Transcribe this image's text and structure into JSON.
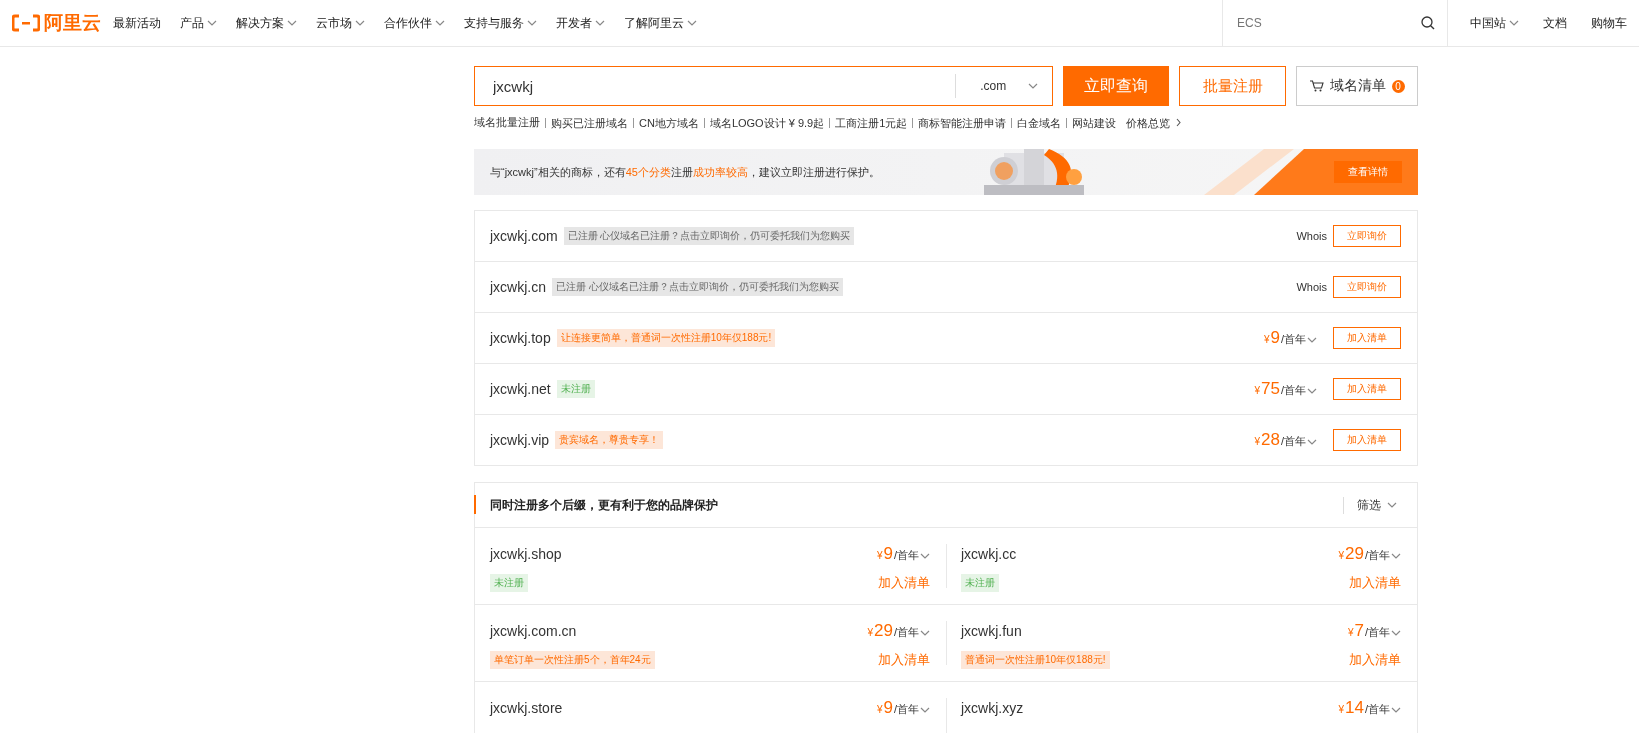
{
  "header": {
    "logo": "阿里云",
    "nav": [
      {
        "label": "最新活动",
        "dropdown": false
      },
      {
        "label": "产品",
        "dropdown": true
      },
      {
        "label": "解决方案",
        "dropdown": true
      },
      {
        "label": "云市场",
        "dropdown": true
      },
      {
        "label": "合作伙伴",
        "dropdown": true
      },
      {
        "label": "支持与服务",
        "dropdown": true
      },
      {
        "label": "开发者",
        "dropdown": true
      },
      {
        "label": "了解阿里云",
        "dropdown": true
      }
    ],
    "search": {
      "placeholder": "ECS"
    },
    "right": [
      {
        "label": "中国站",
        "dropdown": true
      },
      {
        "label": "文档",
        "dropdown": false
      },
      {
        "label": "购物车",
        "dropdown": false
      }
    ]
  },
  "search": {
    "value": "jxcwkj",
    "suffix": ".com",
    "button": "立即查询",
    "batch": "批量注册",
    "cart": {
      "label": "域名清单",
      "count": "0"
    }
  },
  "quick_links": [
    "域名批量注册",
    "购买已注册域名",
    "CN地方域名",
    "域名LOGO设计 ¥ 9.9起",
    "工商注册1元起",
    "商标智能注册申请",
    "白金域名",
    "网站建设"
  ],
  "price_overview": "价格总览",
  "banner": {
    "segments": [
      {
        "text": "与“jxcwkj”相关的商标，还有",
        "highlight": false
      },
      {
        "text": "45个分类",
        "highlight": true
      },
      {
        "text": "注册",
        "highlight": false
      },
      {
        "text": "成功率较高",
        "highlight": true
      },
      {
        "text": "，建议立即注册进行保护。",
        "highlight": false
      }
    ],
    "button": "查看详情"
  },
  "results": [
    {
      "domain": "jxcwkj.com",
      "tag": "已注册 心仪域名已注册？点击立即询价，仍可委托我们为您购买",
      "color": "#e6e6e6",
      "kind": "whois",
      "whois": "Whois",
      "action": "立即询价"
    },
    {
      "domain": "jxcwkj.cn",
      "tag": "已注册 心仪域名已注册？点击立即询价，仍可委托我们为您购买",
      "color": "#e6e6e6",
      "kind": "whois",
      "whois": "Whois",
      "action": "立即询价"
    },
    {
      "domain": "jxcwkj.top",
      "tag": "让连接更简单，普通词一次性注册10年仅188元!",
      "color": "#fde6d8",
      "kind": "price",
      "currency": "¥",
      "price": "9",
      "unit": "/首年",
      "action": "加入清单"
    },
    {
      "domain": "jxcwkj.net",
      "tag": "未注册",
      "color": "#e6f4e6",
      "kind": "price",
      "currency": "¥",
      "price": "75",
      "unit": "/首年",
      "action": "加入清单"
    },
    {
      "domain": "jxcwkj.vip",
      "tag": "贵宾域名，尊贵专享！",
      "color": "#fde6d8",
      "kind": "price",
      "currency": "¥",
      "price": "28",
      "unit": "/首年",
      "action": "加入清单"
    }
  ],
  "more": {
    "title": "同时注册多个后缀，更有利于您的品牌保护",
    "filter": "筛选",
    "items": [
      {
        "domain": "jxcwkj.shop",
        "currency": "¥",
        "price": "9",
        "unit": "/首年",
        "tag": "未注册",
        "color": "#e6f4e6",
        "action": "加入清单"
      },
      {
        "domain": "jxcwkj.cc",
        "currency": "¥",
        "price": "29",
        "unit": "/首年",
        "tag": "未注册",
        "color": "#e6f4e6",
        "action": "加入清单"
      },
      {
        "domain": "jxcwkj.com.cn",
        "currency": "¥",
        "price": "29",
        "unit": "/首年",
        "tag": "单笔订单一次性注册5个，首年24元",
        "color": "#fde6d8",
        "action": "加入清单"
      },
      {
        "domain": "jxcwkj.fun",
        "currency": "¥",
        "price": "7",
        "unit": "/首年",
        "tag": "普通词一次性注册10年仅188元!",
        "color": "#fde6d8",
        "action": "加入清单"
      },
      {
        "domain": "jxcwkj.store",
        "currency": "¥",
        "price": "9",
        "unit": "/首年"
      },
      {
        "domain": "jxcwkj.xyz",
        "currency": "¥",
        "price": "14",
        "unit": "/首年"
      }
    ]
  }
}
